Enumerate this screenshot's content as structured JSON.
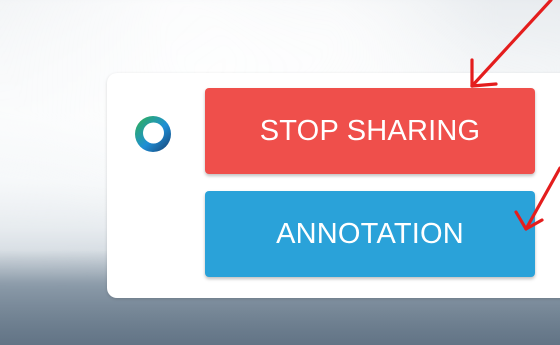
{
  "controls": {
    "stop_sharing_label": "STOP SHARING",
    "annotation_label": "ANNOTATION"
  },
  "icons": {
    "app_logo": "webex-logo-icon",
    "annotation_arrows": "red-arrow-icon"
  },
  "colors": {
    "stop_sharing": "#ef4f4b",
    "annotation": "#2aa2d9",
    "panel": "#ffffff",
    "arrow": "#e41d1d",
    "logo_green": "#2fb24d",
    "logo_blue": "#1f8fd6",
    "logo_dark": "#163d6e"
  }
}
